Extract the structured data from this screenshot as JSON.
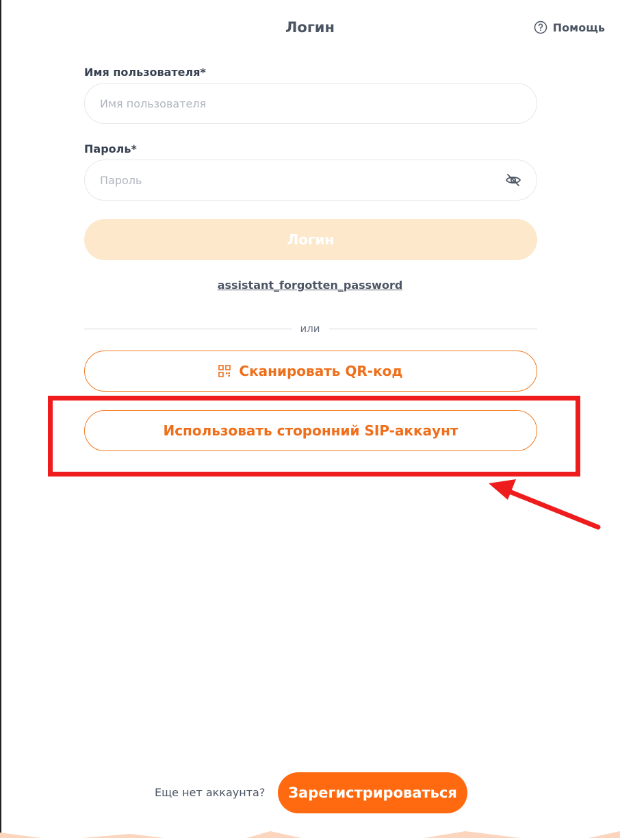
{
  "header": {
    "title": "Логин",
    "help_label": "Помощь"
  },
  "form": {
    "username_label": "Имя пользователя*",
    "username_placeholder": "Имя пользователя",
    "password_label": "Пароль*",
    "password_placeholder": "Пароль",
    "login_button": "Логин",
    "forgot_link": "assistant_forgotten_password",
    "divider_text": "или"
  },
  "alt_login": {
    "qr_button": "Сканировать QR-код",
    "sip_button": "Использовать сторонний SIP-аккаунт"
  },
  "footer": {
    "no_account_text": "Еще нет аккаунта?",
    "register_button": "Зарегистрироваться"
  },
  "colors": {
    "accent": "#ff6a10",
    "login_disabled": "#fde8cc",
    "annotation_red": "#ee1c1c"
  },
  "icons": [
    "help-circle-icon",
    "eye-off-icon",
    "qr-code-icon"
  ]
}
